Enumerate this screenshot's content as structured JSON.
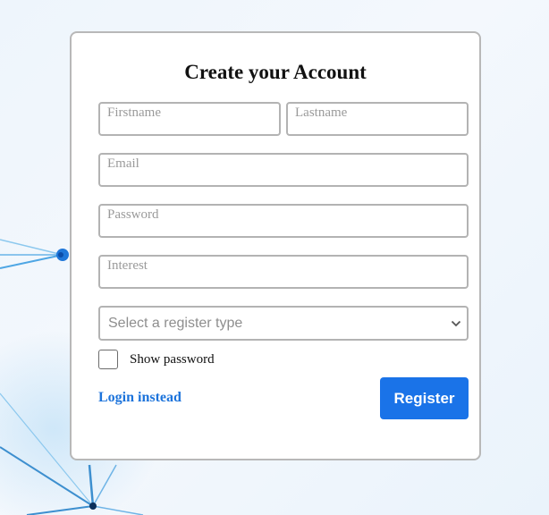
{
  "form": {
    "title": "Create your Account",
    "firstname_placeholder": "Firstname",
    "lastname_placeholder": "Lastname",
    "email_placeholder": "Email",
    "password_placeholder": "Password",
    "interest_placeholder": "Interest",
    "register_type_placeholder": "Select a register type",
    "show_password_label": "Show password",
    "login_link": "Login instead",
    "register_button": "Register"
  },
  "colors": {
    "accent": "#1a73e8",
    "link": "#1c73db",
    "border": "#b3b3b3"
  }
}
